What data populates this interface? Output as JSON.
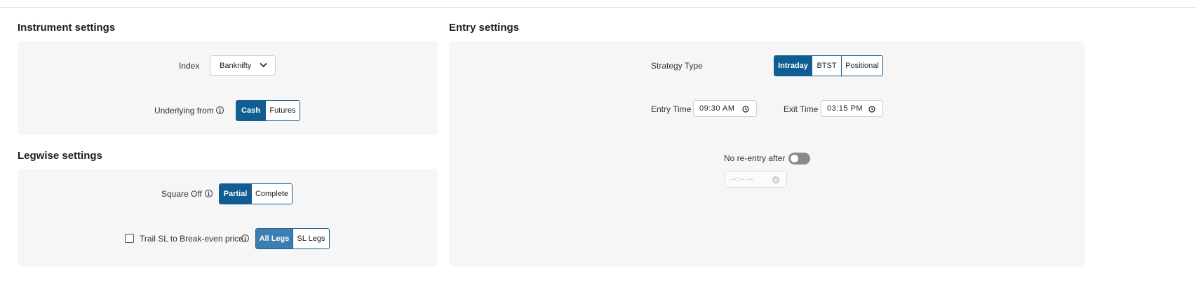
{
  "instrument": {
    "title": "Instrument settings",
    "index_label": "Index",
    "index_value": "Banknifty",
    "underlying_label": "Underlying from",
    "underlying_options": [
      "Cash",
      "Futures"
    ],
    "underlying_selected": "Cash"
  },
  "legwise": {
    "title": "Legwise settings",
    "square_off_label": "Square Off",
    "square_off_options": [
      "Partial",
      "Complete"
    ],
    "square_off_selected": "Partial",
    "trail_label": "Trail SL to Break-even price",
    "trail_checked": false,
    "trail_options": [
      "All Legs",
      "SL Legs"
    ],
    "trail_selected": "All Legs"
  },
  "entry": {
    "title": "Entry settings",
    "strategy_label": "Strategy Type",
    "strategy_options": [
      "Intraday",
      "BTST",
      "Positional"
    ],
    "strategy_selected": "Intraday",
    "entry_time_label": "Entry Time",
    "entry_time_value": "09:30 AM",
    "exit_time_label": "Exit Time",
    "exit_time_value": "03:15 PM",
    "no_reentry_label": "No re-entry after",
    "no_reentry_enabled": false,
    "no_reentry_time_placeholder": "--:-- --"
  },
  "colors": {
    "accent": "#0f5d93",
    "accent_light": "#3b7fb0",
    "card_bg": "#f6f6f6",
    "toggle_off": "#8a8a8a"
  }
}
